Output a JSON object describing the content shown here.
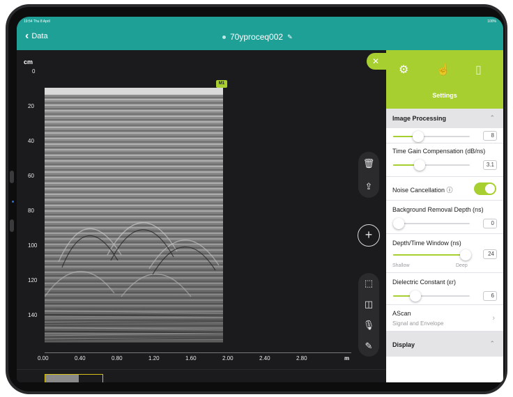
{
  "status": {
    "time": "19:54 Thu 8 April",
    "battery": "100%"
  },
  "nav": {
    "back_label": "Data",
    "title": "70yproceq002"
  },
  "chart": {
    "y_unit": "cm",
    "y_ticks": [
      "0",
      "20",
      "40",
      "60",
      "80",
      "100",
      "120",
      "140"
    ],
    "x_ticks": [
      "0.00",
      "0.40",
      "0.80",
      "1.20",
      "1.60",
      "2.00",
      "2.40",
      "2.80"
    ],
    "x_unit": "m",
    "marker_label": "M1"
  },
  "tools": {
    "top": [
      "trash-icon",
      "share-icon"
    ],
    "bottom": [
      "select-icon",
      "split-icon",
      "microphone-icon",
      "pen-icon"
    ]
  },
  "settings": {
    "title": "Settings",
    "image_processing": {
      "header": "Image Processing",
      "gain_value": "8",
      "tgc_label": "Time Gain Compensation (dB/ns)",
      "tgc_value": "3.1",
      "noise_label": "Noise Cancellation ⓘ",
      "noise_on": true,
      "bg_label": "Background Removal Depth (ns)",
      "bg_value": "0",
      "depth_label": "Depth/Time Window (ns)",
      "depth_value": "24",
      "depth_min": "Shallow",
      "depth_max": "Deep",
      "dielectric_label": "Dielectric Constant (εr)",
      "dielectric_value": "6",
      "ascan_label": "AScan",
      "ascan_sub": "Signal and Envelope"
    },
    "display_header": "Display"
  },
  "colors": {
    "teal": "#1fa097",
    "accent": "#a6cf2f",
    "marker": "#d6c21a"
  }
}
